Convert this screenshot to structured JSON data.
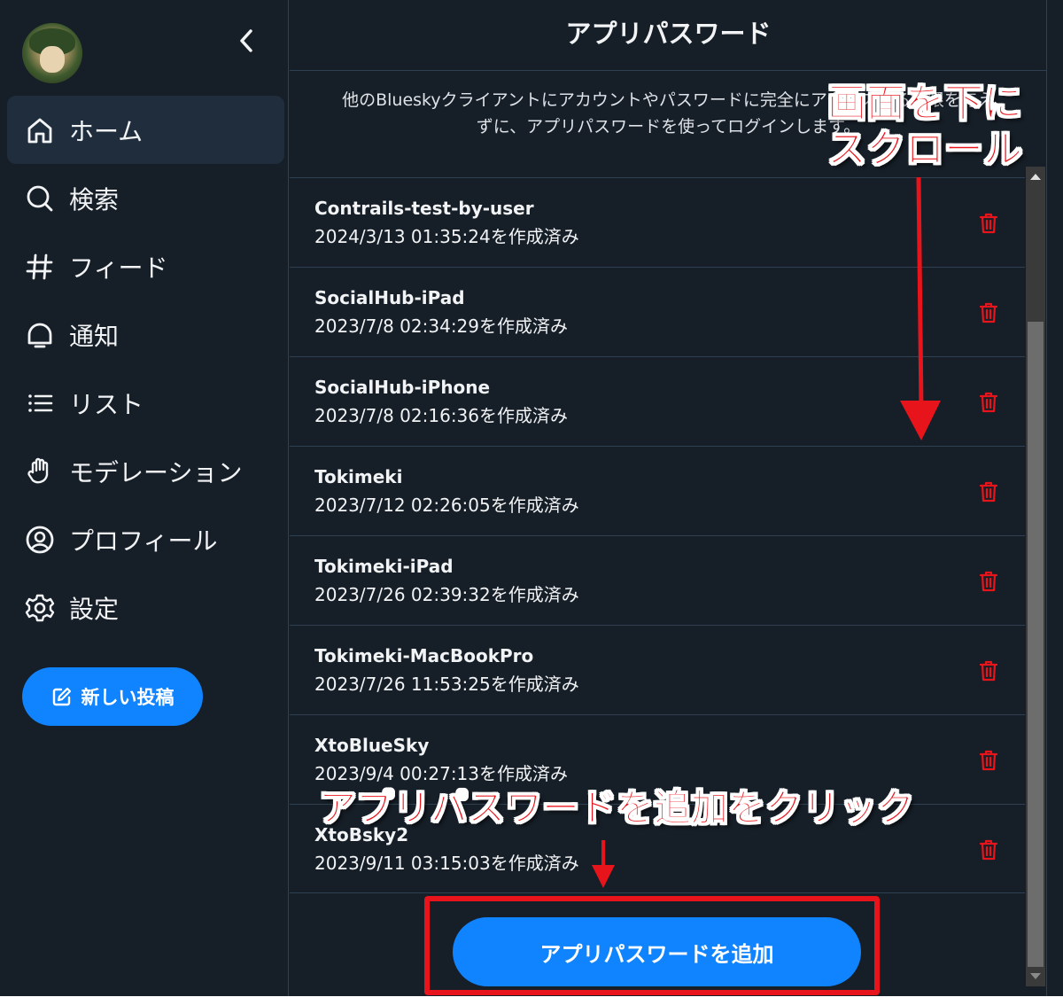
{
  "sidebar": {
    "nav": [
      {
        "label": "ホーム",
        "icon": "home-icon",
        "active": true
      },
      {
        "label": "検索",
        "icon": "search-icon"
      },
      {
        "label": "フィード",
        "icon": "hashtag-icon"
      },
      {
        "label": "通知",
        "icon": "bell-icon"
      },
      {
        "label": "リスト",
        "icon": "list-icon"
      },
      {
        "label": "モデレーション",
        "icon": "hand-icon"
      },
      {
        "label": "プロフィール",
        "icon": "profile-icon"
      },
      {
        "label": "設定",
        "icon": "gear-icon"
      }
    ],
    "new_post_label": "新しい投稿"
  },
  "main": {
    "title": "アプリパスワード",
    "description_line1": "他のBlueskyクライアントにアカウントやパスワードに完全にアクセスする権限を与え",
    "description_line2": "ずに、アプリパスワードを使ってログインします。",
    "passwords": [
      {
        "name": "Contrails-test-by-user",
        "created": "2024/3/13 01:35:24を作成済み"
      },
      {
        "name": "SocialHub-iPad",
        "created": "2023/7/8 02:34:29を作成済み"
      },
      {
        "name": "SocialHub-iPhone",
        "created": "2023/7/8 02:16:36を作成済み"
      },
      {
        "name": "Tokimeki",
        "created": "2023/7/12 02:26:05を作成済み"
      },
      {
        "name": "Tokimeki-iPad",
        "created": "2023/7/26 02:39:32を作成済み"
      },
      {
        "name": "Tokimeki-MacBookPro",
        "created": "2023/7/26 11:53:25を作成済み"
      },
      {
        "name": "XtoBlueSky",
        "created": "2023/9/4 00:27:13を作成済み"
      },
      {
        "name": "XtoBsky2",
        "created": "2023/9/11 03:15:03を作成済み"
      }
    ],
    "add_button_label": "アプリパスワードを追加"
  },
  "annotations": {
    "scroll_line1": "画面を下に",
    "scroll_line2": "スクロール",
    "click": "アプリパスワードを追加をクリック"
  },
  "colors": {
    "background": "#161e27",
    "active_nav": "#202d3d",
    "accent": "#1083fe",
    "delete": "#e8141b",
    "annotation": "#e8141b"
  }
}
